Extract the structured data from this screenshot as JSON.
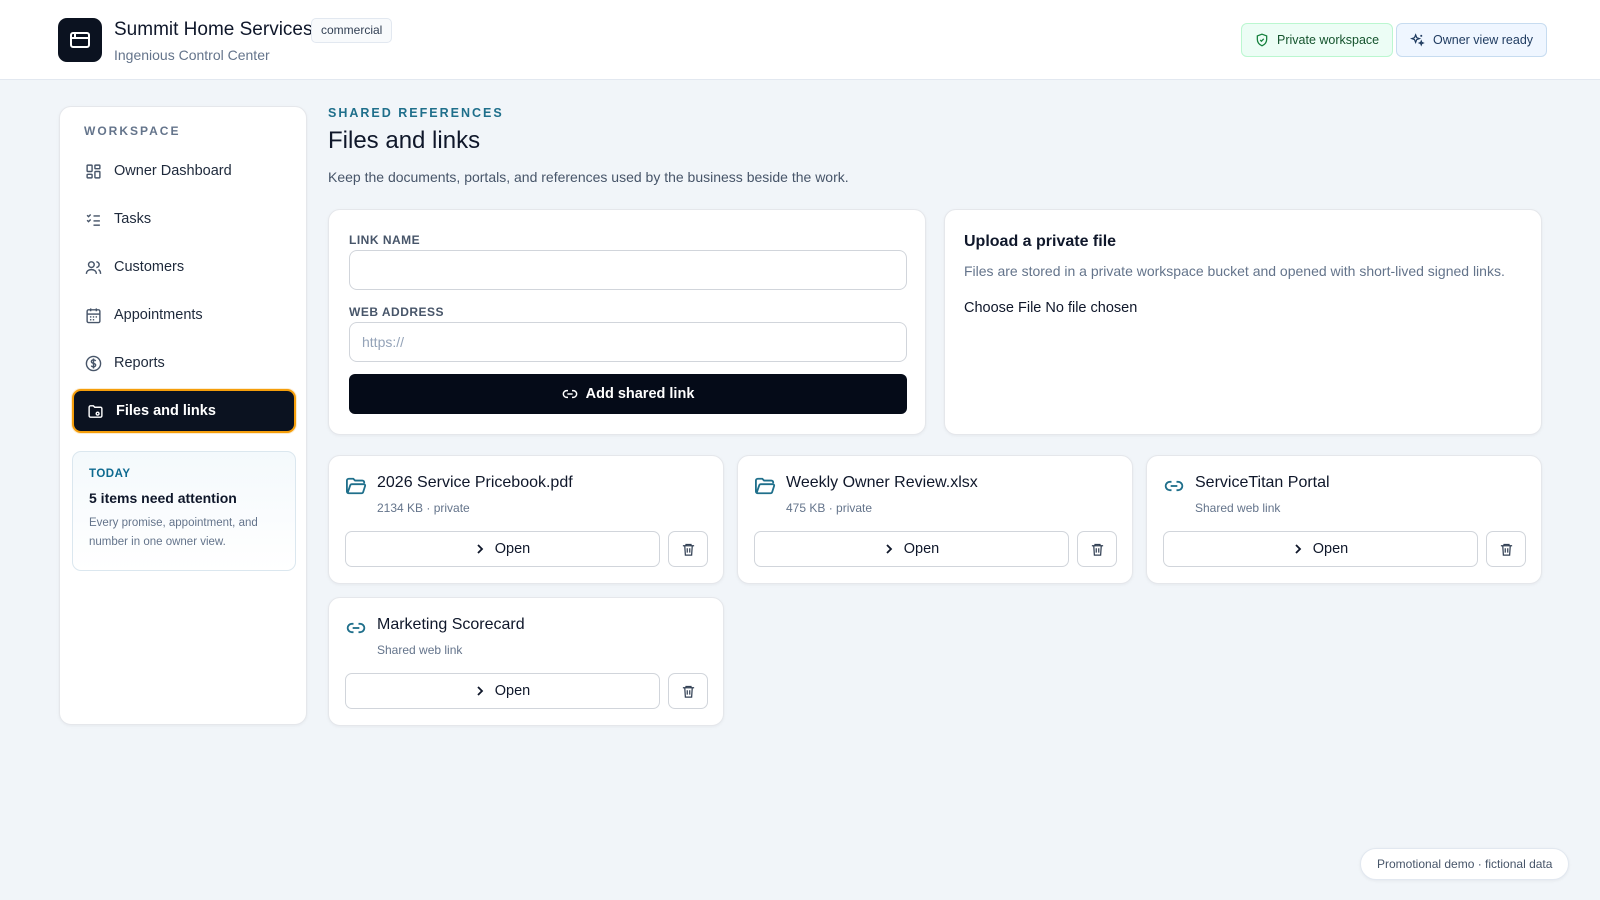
{
  "header": {
    "title": "Summit Home Services",
    "badge": "commercial",
    "subtitle": "Ingenious Control Center",
    "private_label": "Private workspace",
    "owner_label": "Owner view ready"
  },
  "sidebar": {
    "heading": "WORKSPACE",
    "items": [
      {
        "label": "Owner Dashboard",
        "icon": "dashboard-icon"
      },
      {
        "label": "Tasks",
        "icon": "checklist-icon"
      },
      {
        "label": "Customers",
        "icon": "users-icon"
      },
      {
        "label": "Appointments",
        "icon": "calendar-icon"
      },
      {
        "label": "Reports",
        "icon": "dollar-icon"
      },
      {
        "label": "Files and links",
        "icon": "folder-icon",
        "active": true
      }
    ],
    "today": {
      "label": "TODAY",
      "title": "5 items need attention",
      "text": "Every promise, appointment, and number in one owner view."
    }
  },
  "main": {
    "eyebrow": "SHARED REFERENCES",
    "title": "Files and links",
    "description": "Keep the documents, portals, and references used by the business beside the work.",
    "form": {
      "link_name_label": "LINK NAME",
      "link_name_value": "",
      "web_address_label": "WEB ADDRESS",
      "web_address_placeholder": "https://",
      "submit_label": "Add shared link"
    },
    "upload": {
      "title": "Upload a private file",
      "description": "Files are stored in a private workspace bucket and opened with short-lived signed links.",
      "choose_label": "Choose File",
      "status": "No file chosen"
    },
    "resources": [
      {
        "name": "2026 Service Pricebook.pdf",
        "meta": "2134 KB · private",
        "icon": "folder-icon",
        "open_label": "Open"
      },
      {
        "name": "Weekly Owner Review.xlsx",
        "meta": "475 KB · private",
        "icon": "folder-icon",
        "open_label": "Open"
      },
      {
        "name": "ServiceTitan Portal",
        "meta": "Shared web link",
        "icon": "link-icon",
        "open_label": "Open"
      },
      {
        "name": "Marketing Scorecard",
        "meta": "Shared web link",
        "icon": "link-icon",
        "open_label": "Open"
      }
    ]
  },
  "footer": {
    "badge": "Promotional demo · fictional data"
  },
  "colors": {
    "accent": "#0b1220",
    "active_border": "#f59e0b",
    "link_blue": "#1f6f8b"
  }
}
